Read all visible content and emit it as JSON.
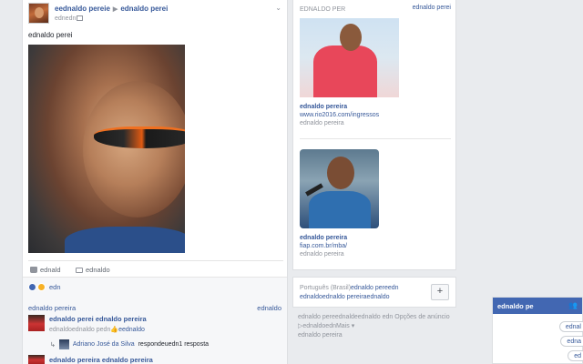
{
  "post": {
    "author_primary": "eednaldo pereie",
    "author_secondary": "ednaldo perei",
    "sub": "ednedn",
    "caption": "ednaldo perei",
    "actions": {
      "like": "ednald",
      "comment": "ednaldo"
    },
    "reactions": {
      "label": "edn"
    },
    "comments_header": {
      "left": "ednaldo pereira",
      "right": "ednaldo"
    },
    "comments": [
      {
        "author": "ednaldo perei ednaldo pereira",
        "text": "",
        "meta": "ednaldoednaldo pedn",
        "meta_link": "eednaldo"
      },
      {
        "author": "ednaldo pereira ednaldo pereira",
        "text": "",
        "meta": "",
        "meta_link": ""
      }
    ],
    "reply": {
      "name": "Adriano José da Silva",
      "text": "respondeuedn1 resposta"
    }
  },
  "sidebar": {
    "heading": "EDNALDO PER",
    "heading_link": "ednaldo perei",
    "ads": [
      {
        "title": "ednaldo pereira",
        "url": "www.rio2016.com/ingressos",
        "by": "ednaldo pereira"
      },
      {
        "title": "ednaldo pereira",
        "url": "fiap.com.br/mba/",
        "by": "ednaldo pereira"
      }
    ],
    "language": {
      "prefix": "Português (Brasil)",
      "links": "ednaldo pereedn ednaldoednaldo pereiraednaldo",
      "plus": "+"
    },
    "footer": "ednaldo pereednaldeednaldo edn Opções de anúncio ▷ednaldoednMais ▾",
    "footer2": "ednaldo pereira"
  },
  "chat": {
    "title": "ednaldo pe",
    "icon": "people-icon",
    "bubbles": [
      "ednal",
      "edna",
      "ed"
    ]
  },
  "colors": {
    "brand": "#4267b2",
    "link": "#365899",
    "background": "#e9ebee"
  }
}
